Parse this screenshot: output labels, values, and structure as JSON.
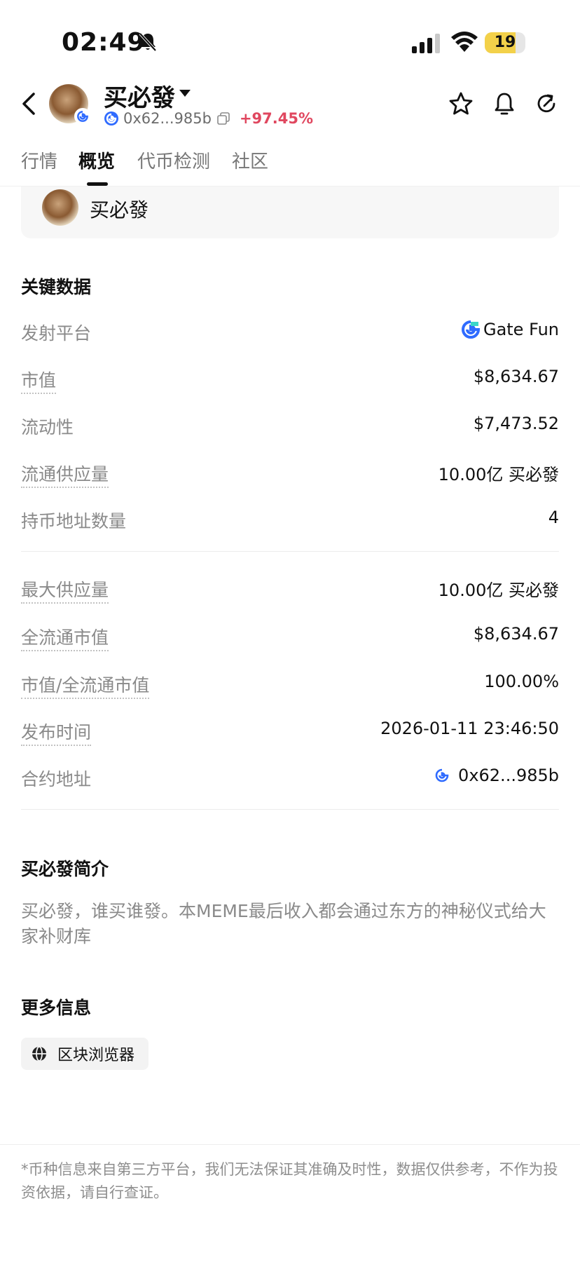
{
  "status_bar": {
    "time": "02:49",
    "battery": "19",
    "icons": [
      "bell-slash-icon",
      "cellular-signal-icon",
      "wifi-icon",
      "battery-icon"
    ]
  },
  "header": {
    "token_name": "买必發",
    "address": "0x62...985b",
    "change": "+97.45%",
    "colors": {
      "change": "#e0475f",
      "chain": "#2f6bff"
    },
    "icons": [
      "back-arrow-icon",
      "star-icon",
      "bell-icon",
      "refresh-icon"
    ]
  },
  "tabs": [
    {
      "label": "行情"
    },
    {
      "label": "概览"
    },
    {
      "label": "代币检测"
    },
    {
      "label": "社区"
    }
  ],
  "active_tab": "概览",
  "card": {
    "token_name": "买必發"
  },
  "key_data": {
    "title": "关键数据",
    "rows": [
      {
        "label": "发射平台",
        "value": "Gate Fun"
      },
      {
        "label": "市值",
        "value": "$8,634.67"
      },
      {
        "label": "流动性",
        "value": "$7,473.52"
      },
      {
        "label": "流通供应量",
        "value": "10.00亿 买必發"
      },
      {
        "label": "持币地址数量",
        "value": "4"
      },
      {
        "label": "最大供应量",
        "value": "10.00亿 买必發"
      },
      {
        "label": "全流通市值",
        "value": "$8,634.67"
      },
      {
        "label": "市值/全流通市值",
        "value": "100.00%"
      },
      {
        "label": "发布时间",
        "value": "2026-01-11 23:46:50"
      },
      {
        "label": "合约地址",
        "value": "0x62...985b"
      }
    ]
  },
  "intro": {
    "title": "买必發简介",
    "text": "买必發，谁买谁發。本MEME最后收入都会通过东方的神秘仪式给大家补财库"
  },
  "more_info": {
    "title": "更多信息",
    "explorer_label": "区块浏览器"
  },
  "disclaimer": "*币种信息来自第三方平台，我们无法保证其准确及时性，数据仅供参考，不作为投资依据，请自行查证。"
}
